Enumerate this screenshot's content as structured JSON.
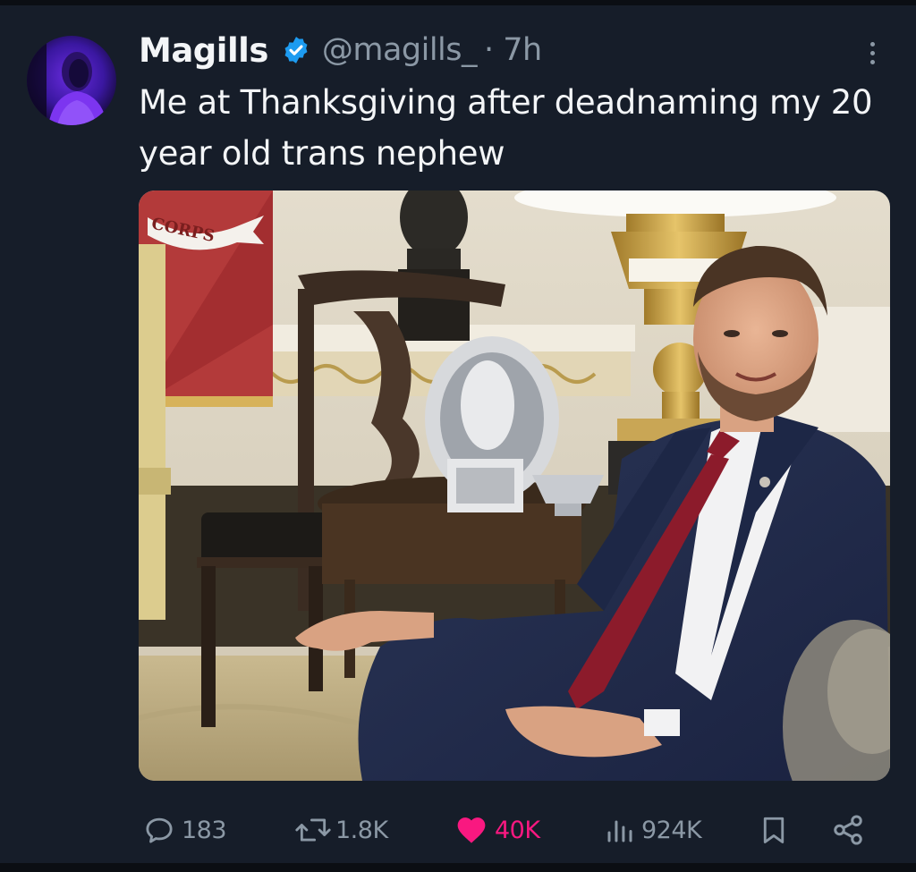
{
  "tweet": {
    "author": {
      "display_name": "Magills",
      "handle": "@magills_",
      "timestamp": "· 7h",
      "verified": true
    },
    "text": "Me at Thanksgiving after deadnaming my 20 year old trans nephew",
    "media": {
      "flag_text": "CORPS"
    }
  },
  "actions": {
    "replies": "183",
    "retweets": "1.8K",
    "likes": "40K",
    "views": "924K"
  },
  "colors": {
    "background": "#161d29",
    "text_primary": "#f3f5f7",
    "text_secondary": "#8b98a5",
    "verified_blue": "#1d9bf0",
    "like_pink": "#f91880"
  },
  "icons": {
    "verified": "verified-badge-icon",
    "more": "more-options-icon",
    "reply": "reply-icon",
    "retweet": "retweet-icon",
    "like": "heart-icon",
    "views": "views-chart-icon",
    "bookmark": "bookmark-icon",
    "share": "share-icon"
  }
}
